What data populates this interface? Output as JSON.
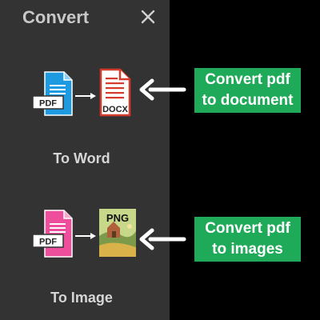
{
  "panel": {
    "title": "Convert",
    "close_icon": "close-icon"
  },
  "options": [
    {
      "label": "To Word",
      "source_badge": "PDF",
      "target_badge": "DOCX",
      "source_icon": "pdf-file-icon",
      "target_icon": "docx-file-icon",
      "source_color": "#1e9be0",
      "target_color": "#d63a2a"
    },
    {
      "label": "To Image",
      "source_badge": "PDF",
      "target_badge": "PNG",
      "source_icon": "pdf-file-icon",
      "target_icon": "png-image-icon",
      "source_color": "#ee4f9d",
      "target_color": "#c8d88a"
    }
  ],
  "callouts": [
    {
      "line1": "Convert pdf",
      "line2": "to document",
      "color": "#1faa59"
    },
    {
      "line1": "Convert pdf",
      "line2": "to images",
      "color": "#1faa59"
    }
  ]
}
